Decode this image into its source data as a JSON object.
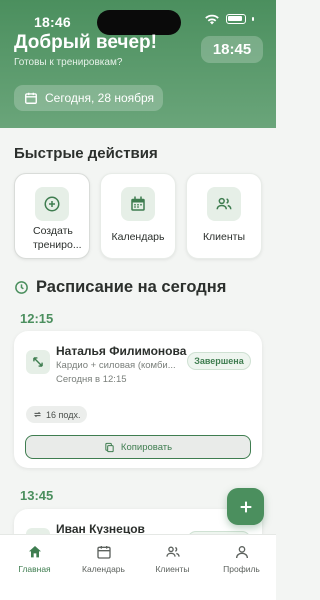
{
  "status_bar": {
    "time": "18:46"
  },
  "header": {
    "greeting": "Добрый вечер!",
    "subtitle": "Готовы к тренировкам?",
    "clock": "18:45",
    "date": "Сегодня, 28 ноября"
  },
  "quick_actions": {
    "title": "Быстрые действия",
    "items": [
      {
        "label": "Создать трениро...",
        "icon": "plus-circle-icon"
      },
      {
        "label": "Календарь",
        "icon": "calendar-icon"
      },
      {
        "label": "Клиенты",
        "icon": "users-icon"
      }
    ]
  },
  "schedule": {
    "title": "Расписание на сегодня",
    "sessions": [
      {
        "time": "12:15",
        "client": "Наталья Филимонова",
        "type": "Кардио + силовая (комби...",
        "when": "Сегодня в 12:15",
        "status": "Завершена",
        "approaches": "16 подх.",
        "copy_label": "Копировать"
      },
      {
        "time": "13:45",
        "client": "Иван Кузнецов"
      }
    ]
  },
  "tabbar": {
    "items": [
      {
        "label": "Главная",
        "active": true
      },
      {
        "label": "Календарь",
        "active": false
      },
      {
        "label": "Клиенты",
        "active": false
      },
      {
        "label": "Профиль",
        "active": false
      }
    ]
  },
  "colors": {
    "accent": "#4b8f5e",
    "background": "#f3f5f3"
  }
}
